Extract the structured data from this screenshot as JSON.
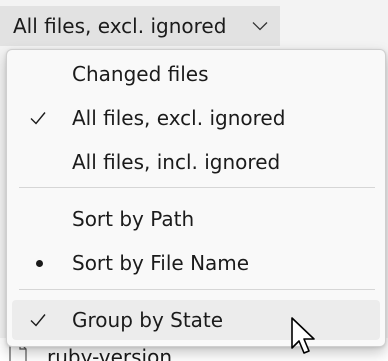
{
  "filter": {
    "selected": "All files, excl. ignored",
    "chevron_icon": "chevron-down-icon"
  },
  "menu": {
    "items": [
      {
        "label": "Changed files",
        "indicator": "none"
      },
      {
        "label": "All files, excl. ignored",
        "indicator": "checkmark"
      },
      {
        "label": "All files, incl. ignored",
        "indicator": "none"
      },
      {
        "label": "Sort by Path",
        "indicator": "none"
      },
      {
        "label": "Sort by File Name",
        "indicator": "bullet"
      },
      {
        "label": "Group by State",
        "indicator": "checkmark",
        "hovered": true
      }
    ]
  },
  "file_list": {
    "partial_row": {
      "name": "ruby-version",
      "icon": "file-icon"
    }
  },
  "colors": {
    "menu_background": "#f9f9f9",
    "hover_background": "#ececec",
    "dropdown_background": "#e2e2e2"
  }
}
